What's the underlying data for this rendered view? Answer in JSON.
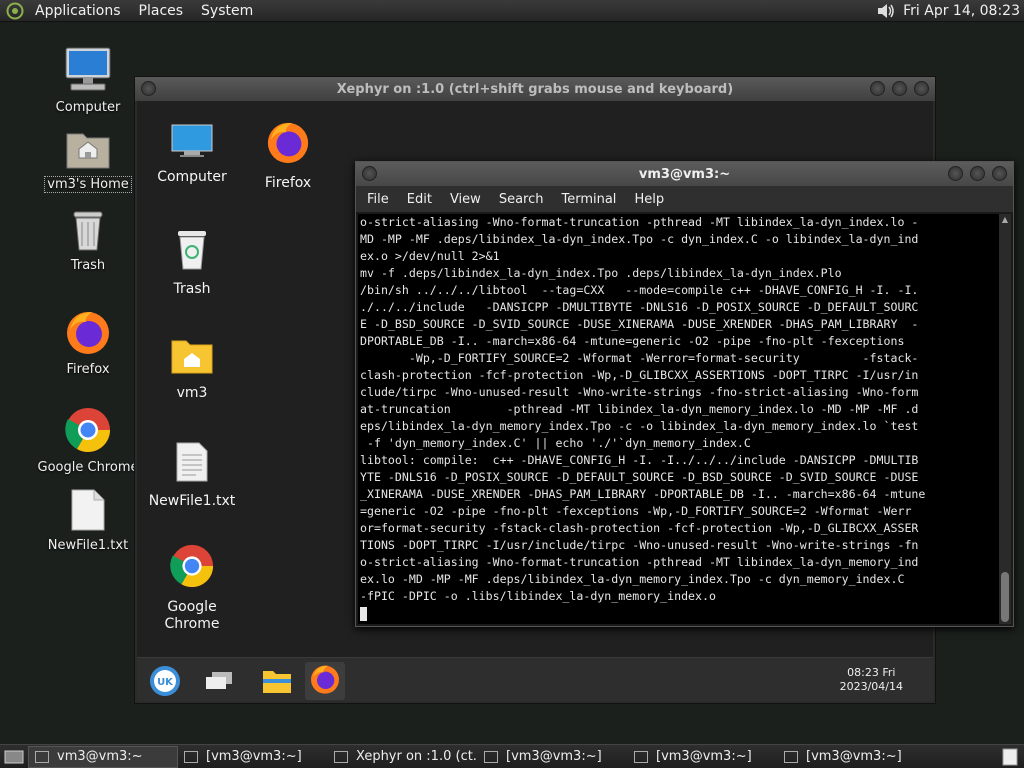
{
  "top_panel": {
    "menus": [
      "Applications",
      "Places",
      "System"
    ],
    "clock": "Fri Apr 14, 08:23"
  },
  "desktop_icons": [
    {
      "label": "Computer"
    },
    {
      "label": "vm3's Home"
    },
    {
      "label": "Trash"
    },
    {
      "label": "Firefox"
    },
    {
      "label": "Google Chrome"
    },
    {
      "label": "NewFile1.txt"
    }
  ],
  "xephyr": {
    "title": "Xephyr on :1.0 (ctrl+shift grabs mouse and keyboard)",
    "icons": [
      {
        "label": "Computer"
      },
      {
        "label": "Firefox"
      },
      {
        "label": "Trash"
      },
      {
        "label": "vm3"
      },
      {
        "label": "NewFile1.txt"
      },
      {
        "label": "Google Chrome"
      }
    ],
    "panel_clock_time": "08:23 Fri",
    "panel_clock_date": "2023/04/14"
  },
  "terminal": {
    "title": "vm3@vm3:~",
    "menu": [
      "File",
      "Edit",
      "View",
      "Search",
      "Terminal",
      "Help"
    ],
    "lines": [
      "o-strict-aliasing -Wno-format-truncation -pthread -MT libindex_la-dyn_index.lo -",
      "MD -MP -MF .deps/libindex_la-dyn_index.Tpo -c dyn_index.C -o libindex_la-dyn_ind",
      "ex.o >/dev/null 2>&1",
      "mv -f .deps/libindex_la-dyn_index.Tpo .deps/libindex_la-dyn_index.Plo",
      "/bin/sh ../../../libtool  --tag=CXX   --mode=compile c++ -DHAVE_CONFIG_H -I. -I.",
      "./../../include   -DANSICPP -DMULTIBYTE -DNLS16 -D_POSIX_SOURCE -D_DEFAULT_SOURC",
      "E -D_BSD_SOURCE -D_SVID_SOURCE -DUSE_XINERAMA -DUSE_XRENDER -DHAS_PAM_LIBRARY  -",
      "DPORTABLE_DB -I.. -march=x86-64 -mtune=generic -O2 -pipe -fno-plt -fexceptions",
      "       -Wp,-D_FORTIFY_SOURCE=2 -Wformat -Werror=format-security         -fstack-",
      "clash-protection -fcf-protection -Wp,-D_GLIBCXX_ASSERTIONS -DOPT_TIRPC -I/usr/in",
      "clude/tirpc -Wno-unused-result -Wno-write-strings -fno-strict-aliasing -Wno-form",
      "at-truncation        -pthread -MT libindex_la-dyn_memory_index.lo -MD -MP -MF .d",
      "eps/libindex_la-dyn_memory_index.Tpo -c -o libindex_la-dyn_memory_index.lo `test",
      " -f 'dyn_memory_index.C' || echo './'`dyn_memory_index.C",
      "libtool: compile:  c++ -DHAVE_CONFIG_H -I. -I../../../include -DANSICPP -DMULTIB",
      "YTE -DNLS16 -D_POSIX_SOURCE -D_DEFAULT_SOURCE -D_BSD_SOURCE -D_SVID_SOURCE -DUSE",
      "_XINERAMA -DUSE_XRENDER -DHAS_PAM_LIBRARY -DPORTABLE_DB -I.. -march=x86-64 -mtune",
      "=generic -O2 -pipe -fno-plt -fexceptions -Wp,-D_FORTIFY_SOURCE=2 -Wformat -Werr",
      "or=format-security -fstack-clash-protection -fcf-protection -Wp,-D_GLIBCXX_ASSER",
      "TIONS -DOPT_TIRPC -I/usr/include/tirpc -Wno-unused-result -Wno-write-strings -fn",
      "o-strict-aliasing -Wno-format-truncation -pthread -MT libindex_la-dyn_memory_ind",
      "ex.lo -MD -MP -MF .deps/libindex_la-dyn_memory_index.Tpo -c dyn_memory_index.C",
      "-fPIC -DPIC -o .libs/libindex_la-dyn_memory_index.o"
    ]
  },
  "taskbar": [
    {
      "label": "vm3@vm3:~",
      "active": true
    },
    {
      "label": "[vm3@vm3:~]",
      "active": false
    },
    {
      "label": "Xephyr on :1.0 (ct...",
      "active": false
    },
    {
      "label": "[vm3@vm3:~]",
      "active": false
    },
    {
      "label": "[vm3@vm3:~]",
      "active": false
    },
    {
      "label": "[vm3@vm3:~]",
      "active": false
    }
  ]
}
